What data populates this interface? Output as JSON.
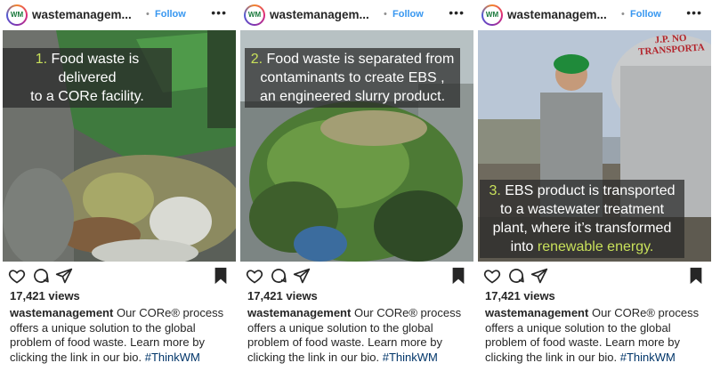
{
  "posts": [
    {
      "username": "wastemanagem...",
      "follow_label": "Follow",
      "dot": "•",
      "more": "•••",
      "avatar_text": "WM",
      "overlay_num": "1.",
      "overlay_lines": [
        "Food waste is delivered",
        "to a CORe facility."
      ],
      "views": "17,421 views",
      "author": "wastemanagement",
      "description": "Our CORe® process offers a unique solution to the global problem of food waste. Learn more by clicking the link in our bio.",
      "hashtag": "#ThinkWM"
    },
    {
      "username": "wastemanagem...",
      "follow_label": "Follow",
      "dot": "•",
      "more": "•••",
      "avatar_text": "WM",
      "overlay_num": "2.",
      "overlay_lines": [
        "Food waste is separated from",
        "contaminants to create EBS ,",
        "an engineered slurry product."
      ],
      "views": "17,421 views",
      "author": "wastemanagement",
      "description": "Our CORe® process offers a unique solution to the global problem of food waste. Learn more by clicking the link in our bio.",
      "hashtag": "#ThinkWM"
    },
    {
      "username": "wastemanagem...",
      "follow_label": "Follow",
      "dot": "•",
      "more": "•••",
      "avatar_text": "WM",
      "overlay_num": "3.",
      "overlay_lines": [
        "EBS product is transported",
        "to a wastewater treatment",
        "plant, where it’s transformed"
      ],
      "overlay_last_prefix": "into ",
      "overlay_last_highlight": "renewable energy.",
      "truck_text": "J.P. NO\nTRANSPORTA",
      "views": "17,421 views",
      "author": "wastemanagement",
      "description": "Our CORe® process offers a unique solution to the global problem of food waste. Learn more by clicking the link in our bio.",
      "hashtag": "#ThinkWM"
    }
  ],
  "icons": [
    "heart-icon",
    "comment-icon",
    "share-icon",
    "bookmark-icon"
  ],
  "colors": {
    "link": "#3897f0",
    "hashtag": "#003569",
    "accent_text": "#c8e05a"
  }
}
